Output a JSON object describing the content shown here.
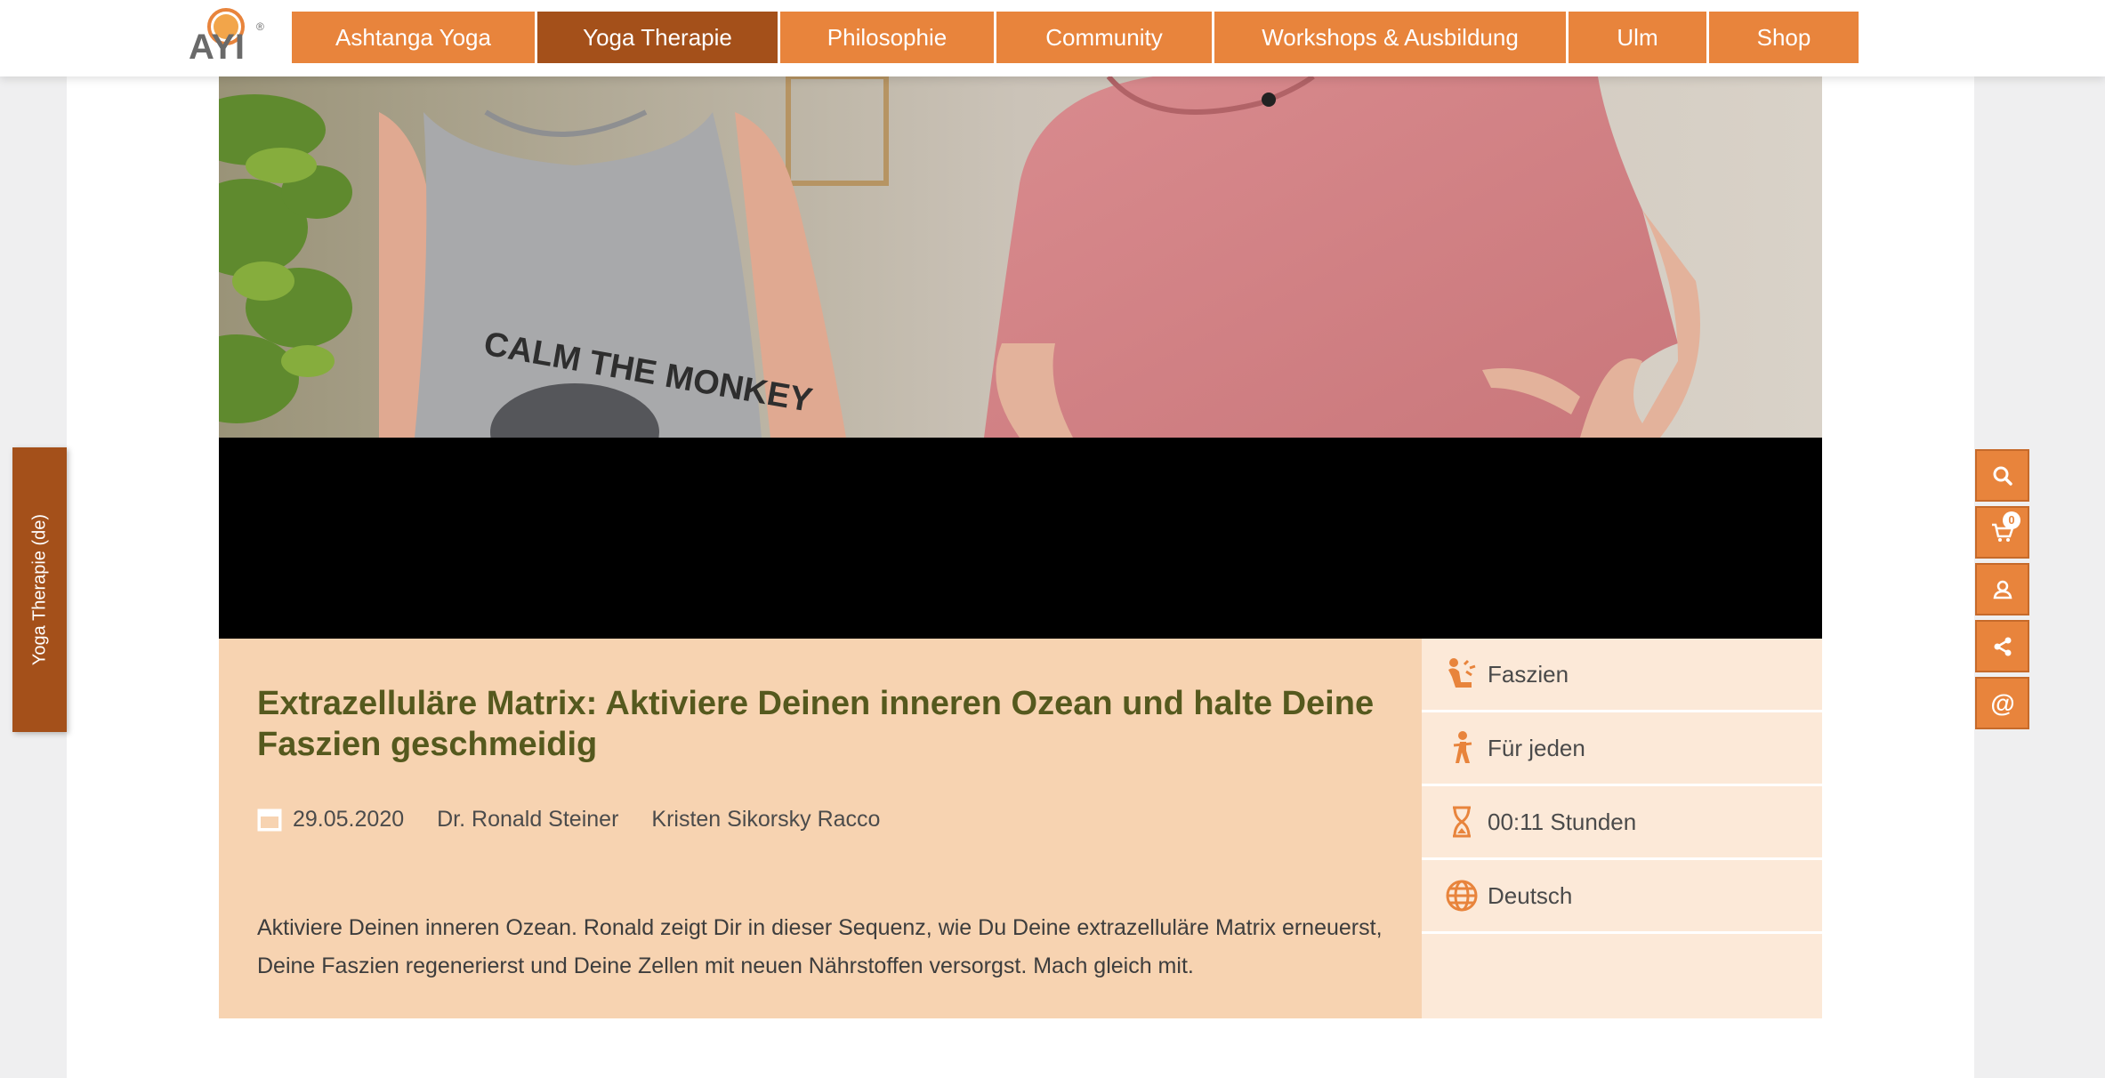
{
  "nav": {
    "items": [
      {
        "label": "Ashtanga Yoga"
      },
      {
        "label": "Yoga Therapie"
      },
      {
        "label": "Philosophie"
      },
      {
        "label": "Community"
      },
      {
        "label": "Workshops & Ausbildung"
      },
      {
        "label": "Ulm"
      },
      {
        "label": "Shop"
      }
    ],
    "active_index": 1
  },
  "logo": {
    "text": "AYI",
    "registered_mark": "®"
  },
  "video": {
    "shirt_print": "CALM THE MONKEY"
  },
  "article": {
    "title": "Extrazelluläre Matrix: Aktiviere Deinen inneren Ozean und halte Deine Faszien geschmeidig",
    "date": "29.05.2020",
    "authors": [
      "Dr. Ronald Steiner",
      "Kristen Sikorsky Racco"
    ],
    "description": "Aktiviere Deinen inneren Ozean. Ronald zeigt Dir in dieser Sequenz, wie Du Deine extrazelluläre Matrix erneuerst, Deine Faszien regenerierst und Deine Zellen mit neuen Nährstoffen versorgst. Mach gleich mit."
  },
  "info": {
    "items": [
      {
        "icon": "fascia-icon",
        "label": "Faszien"
      },
      {
        "icon": "person-level-icon",
        "label": "Für jeden"
      },
      {
        "icon": "hourglass-icon",
        "label": "00:11 Stunden"
      },
      {
        "icon": "globe-icon",
        "label": "Deutsch"
      }
    ]
  },
  "side_tab": {
    "label": "Yoga Therapie (de)"
  },
  "tools": {
    "items": [
      {
        "icon": "search-icon"
      },
      {
        "icon": "cart-icon"
      },
      {
        "icon": "user-icon"
      },
      {
        "icon": "share-icon"
      },
      {
        "icon": "at-icon"
      }
    ],
    "cart_count": "0"
  },
  "colors": {
    "accent": "#e8843c",
    "accent_dark": "#a4501a",
    "content_bg": "#f7d3b1",
    "panel_bg": "#fce9d8",
    "title": "#55591e"
  }
}
